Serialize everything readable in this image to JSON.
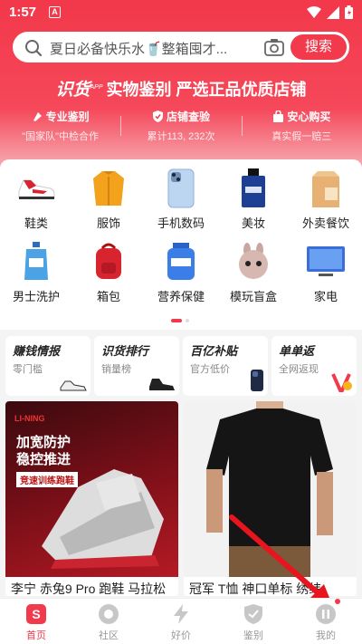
{
  "status": {
    "time": "1:57",
    "notif": "A"
  },
  "search": {
    "placeholder": "夏日必备快乐水🥤整箱囤才...",
    "button": "搜索"
  },
  "slogan": {
    "brand": "识货",
    "app": "APP",
    "text": "实物鉴别 严选正品优质店铺"
  },
  "features": [
    {
      "title": "专业鉴别",
      "sub": "\"国家队\"中检合作"
    },
    {
      "title": "店铺查验",
      "sub": "累计113, 232次"
    },
    {
      "title": "安心购买",
      "sub": "真实假一赔三"
    }
  ],
  "categories": [
    {
      "label": "鞋类",
      "icon": "sneaker-icon"
    },
    {
      "label": "服饰",
      "icon": "jacket-icon"
    },
    {
      "label": "手机数码",
      "icon": "phone-icon"
    },
    {
      "label": "美妆",
      "icon": "perfume-icon"
    },
    {
      "label": "外卖餐饮",
      "icon": "takeout-bag-icon"
    },
    {
      "label": "男士洗护",
      "icon": "shampoo-icon"
    },
    {
      "label": "箱包",
      "icon": "backpack-icon"
    },
    {
      "label": "营养保健",
      "icon": "supplement-icon"
    },
    {
      "label": "模玩盲盒",
      "icon": "toy-figure-icon"
    },
    {
      "label": "家电",
      "icon": "tv-icon"
    }
  ],
  "promos": [
    {
      "title": "赚钱情报",
      "sub": "零门槛"
    },
    {
      "title": "识货排行",
      "sub": "销量榜"
    },
    {
      "title": "百亿补贴",
      "sub": "官方低价"
    },
    {
      "title": "单单返",
      "sub": "全网返现"
    }
  ],
  "products": [
    {
      "title": "李宁 赤兔9 Pro 跑鞋 马拉松",
      "logo": "LI-NING",
      "slogan1": "加宽防护",
      "slogan2": "稳控推进",
      "tag": "竞速训练跑鞋"
    },
    {
      "title": "冠军 T恤 神口单标 绣纬"
    }
  ],
  "tabs": [
    {
      "label": "首页",
      "active": true
    },
    {
      "label": "社区"
    },
    {
      "label": "好价"
    },
    {
      "label": "鉴别"
    },
    {
      "label": "我的"
    }
  ],
  "colors": {
    "accent": "#f23a4c"
  }
}
